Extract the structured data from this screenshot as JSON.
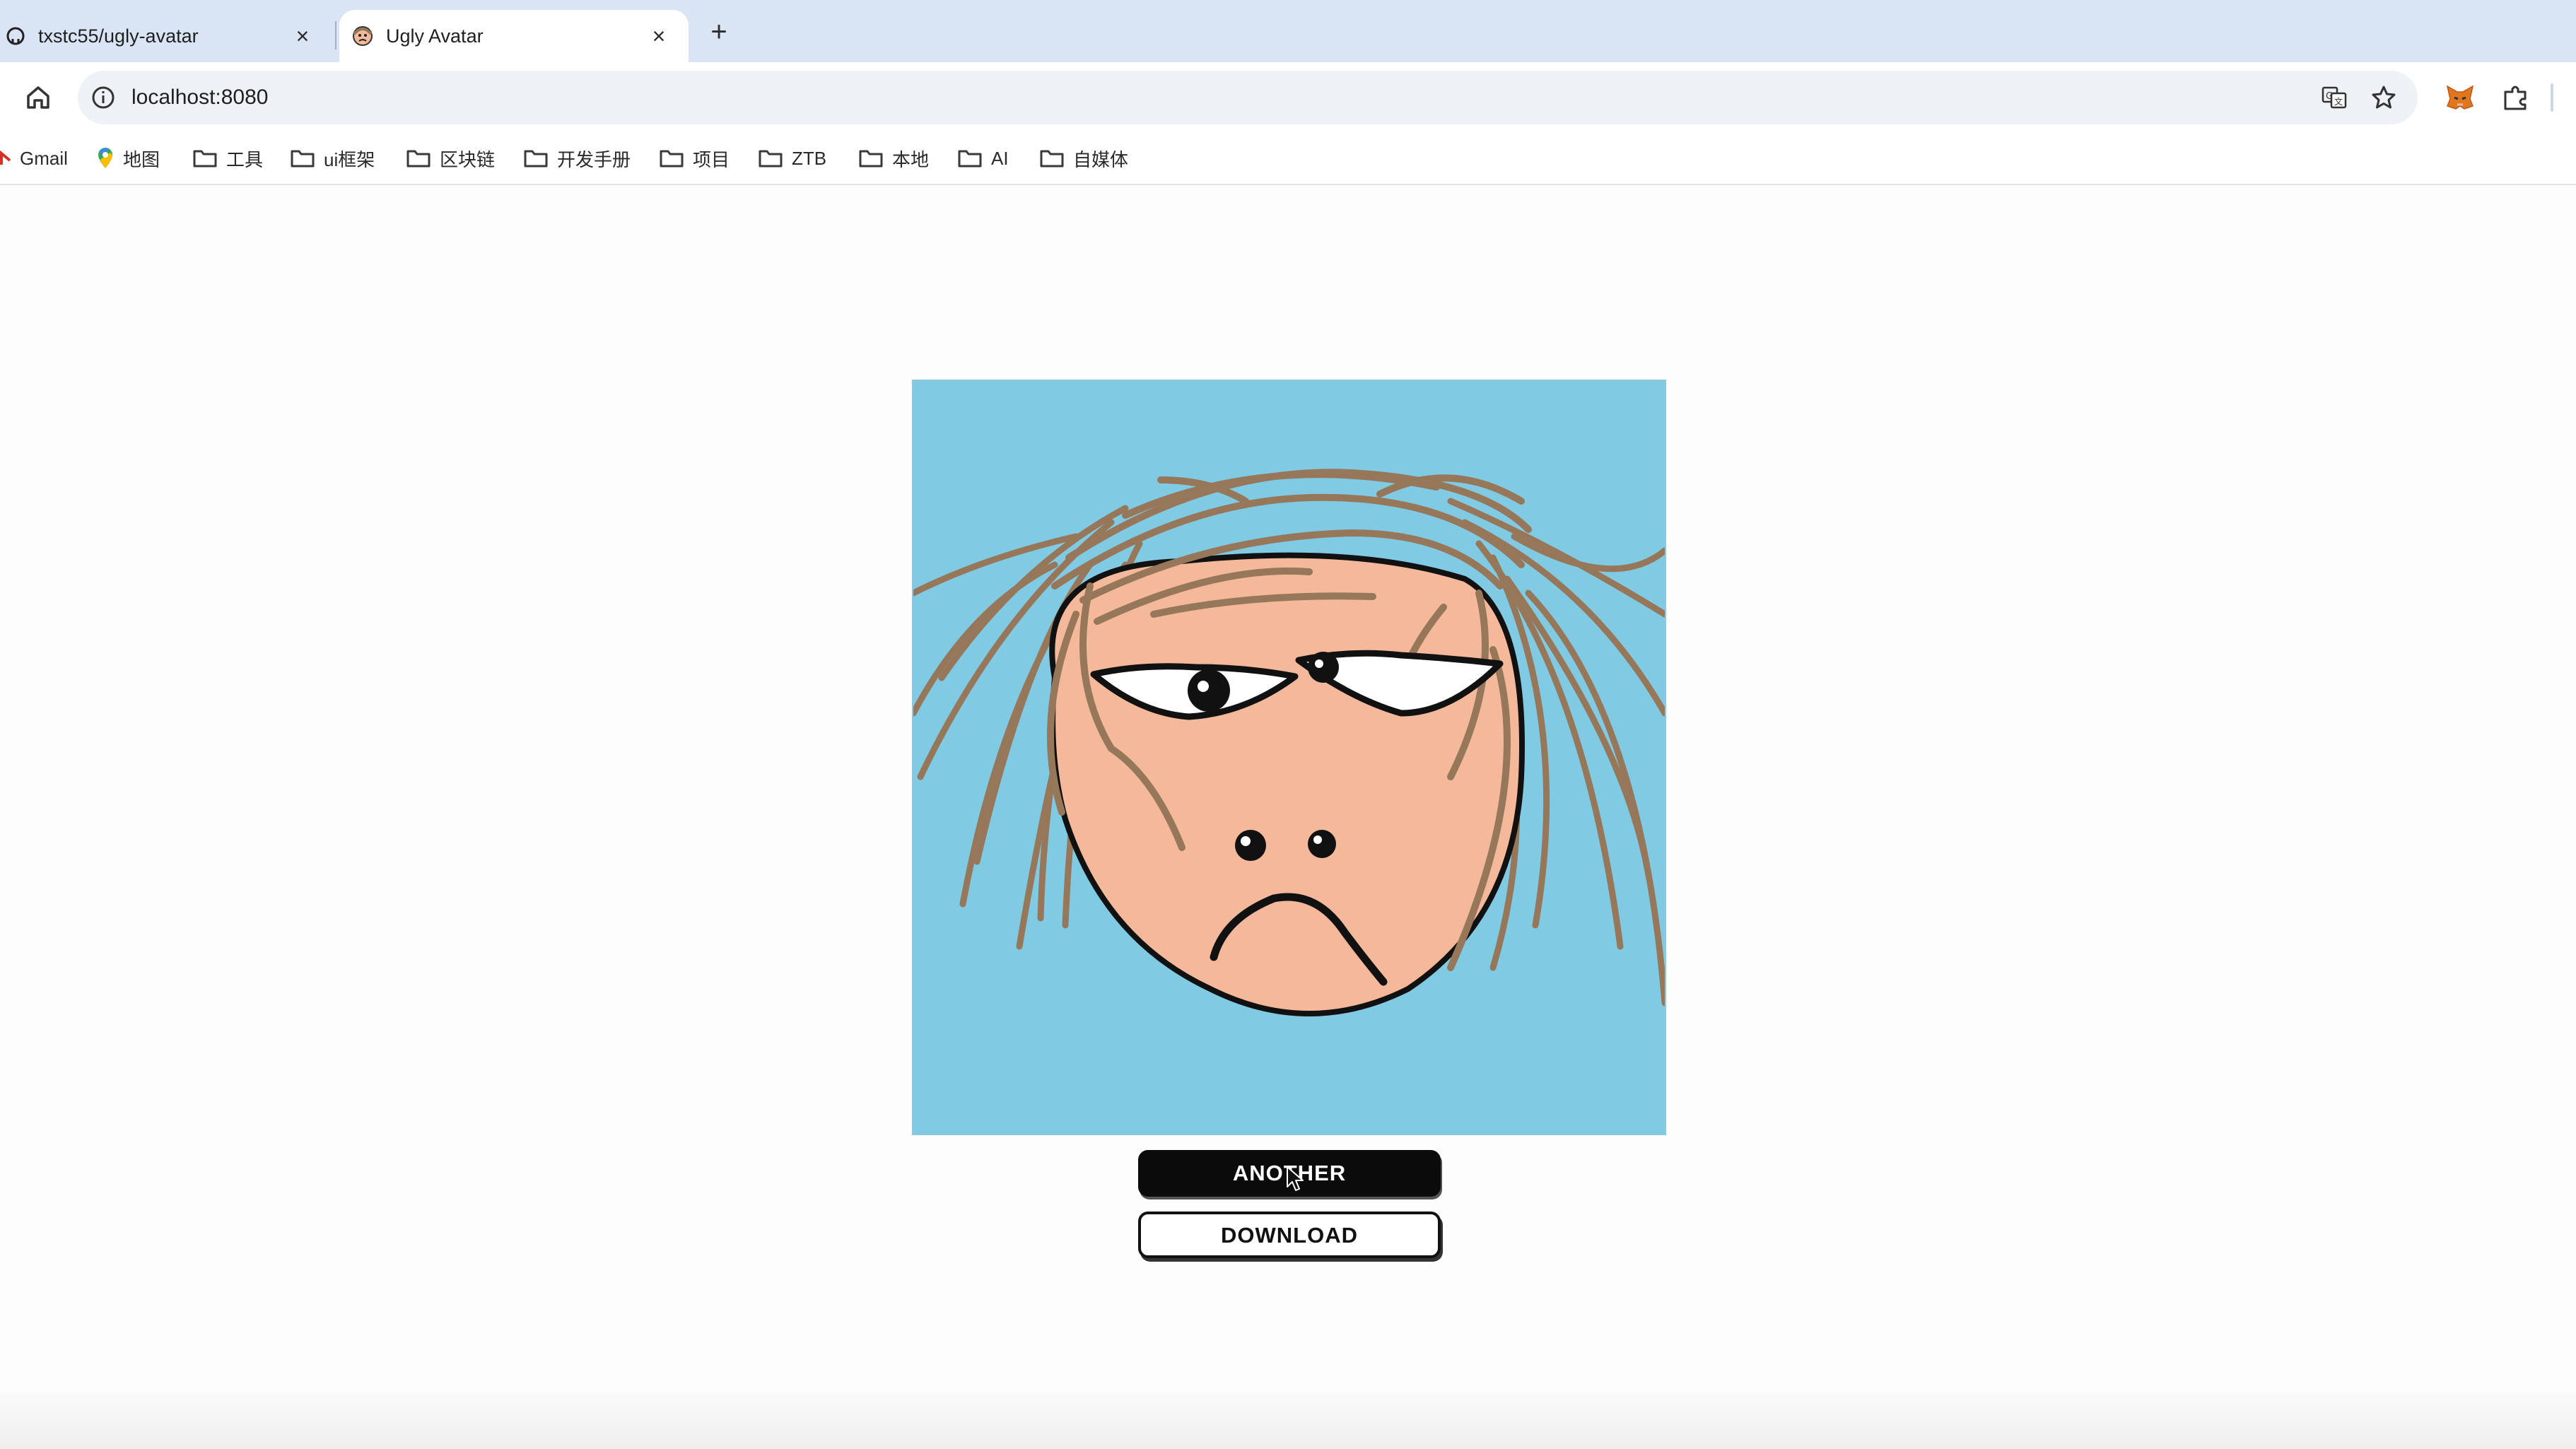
{
  "browser": {
    "tabs": [
      {
        "title": "txstc55/ugly-avatar",
        "icon": "github-icon",
        "active": false
      },
      {
        "title": "Ugly Avatar",
        "icon": "avatar-favicon",
        "active": true
      }
    ],
    "url": "localhost:8080",
    "bookmarks": [
      {
        "label": "Gmail",
        "icon": "gmail-icon"
      },
      {
        "label": "地图",
        "icon": "maps-icon"
      },
      {
        "label": "工具",
        "icon": "folder-icon"
      },
      {
        "label": "ui框架",
        "icon": "folder-icon"
      },
      {
        "label": "区块链",
        "icon": "folder-icon"
      },
      {
        "label": "开发手册",
        "icon": "folder-icon"
      },
      {
        "label": "项目",
        "icon": "folder-icon"
      },
      {
        "label": "ZTB",
        "icon": "folder-icon"
      },
      {
        "label": "本地",
        "icon": "folder-icon"
      },
      {
        "label": "AI",
        "icon": "folder-icon"
      },
      {
        "label": "自媒体",
        "icon": "folder-icon"
      }
    ]
  },
  "page": {
    "avatar": {
      "background_color": "#80cae4",
      "skin_color": "#f4b89a",
      "hair_color": "#97775a",
      "mood": "frown"
    },
    "buttons": {
      "another": "ANOTHER",
      "download": "DOWNLOAD"
    }
  }
}
